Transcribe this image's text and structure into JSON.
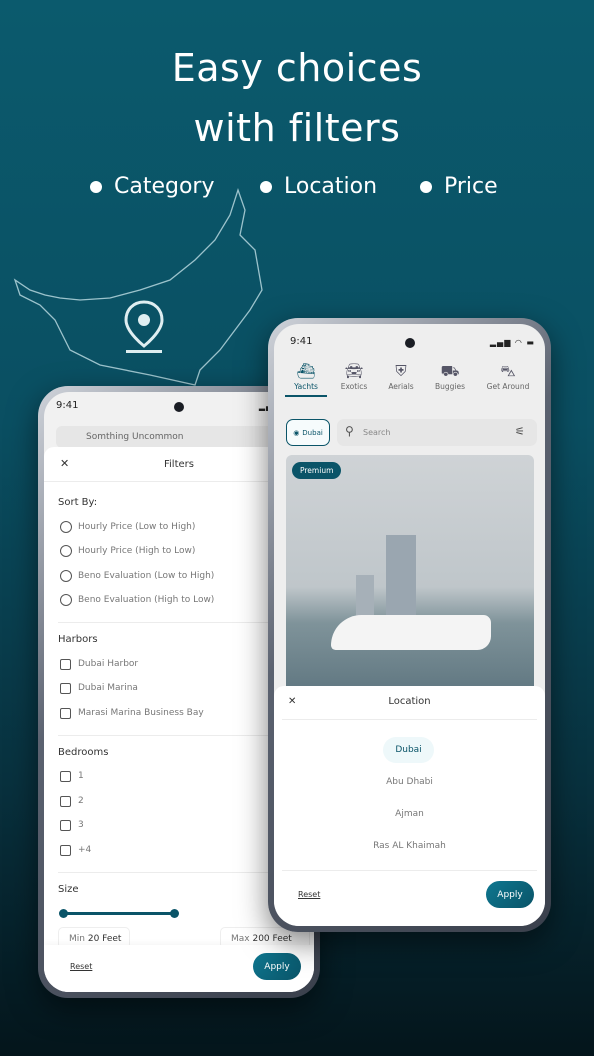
{
  "headline": {
    "line1": "Easy choices",
    "line2": "with filters",
    "bullets": [
      "Category",
      "Location",
      "Price"
    ]
  },
  "colors": {
    "accent": "#0a5468",
    "background_top": "#0b5a6d",
    "background_bottom": "#04151b"
  },
  "filters_phone": {
    "status_time": "9:41",
    "background_item": "Somthing Uncommon",
    "title": "Filters",
    "sort_label": "Sort By:",
    "sort_options": [
      "Hourly Price (Low to High)",
      "Hourly Price (High to Low)",
      "Beno Evaluation (Low to High)",
      "Beno Evaluation (High to Low)"
    ],
    "harbors_label": "Harbors",
    "harbors": [
      "Dubai Harbor",
      "Dubai Marina",
      "Marasi Marina Business Bay"
    ],
    "bedrooms_label": "Bedrooms",
    "bedrooms": [
      "1",
      "2",
      "3",
      "+4"
    ],
    "size_label": "Size",
    "min_label": "Min",
    "min_value": "20 Feet",
    "max_label": "Max",
    "max_value": "200 Feet",
    "reset": "Reset",
    "apply": "Apply"
  },
  "location_phone": {
    "status_time": "9:41",
    "tabs": [
      {
        "label": "Yachts",
        "icon": "yacht-icon",
        "active": true
      },
      {
        "label": "Exotics",
        "icon": "car-icon"
      },
      {
        "label": "Aerials",
        "icon": "helicopter-icon"
      },
      {
        "label": "Buggies",
        "icon": "buggy-icon"
      },
      {
        "label": "Get Around",
        "icon": "car-front-icon"
      }
    ],
    "location_chip": "Dubai",
    "search_placeholder": "Search",
    "badge": "Premium",
    "sheet_title": "Location",
    "locations": [
      "Dubai",
      "Abu Dhabi",
      "Ajman",
      "Ras AL Khaimah"
    ],
    "selected": "Dubai",
    "reset": "Reset",
    "apply": "Apply"
  }
}
